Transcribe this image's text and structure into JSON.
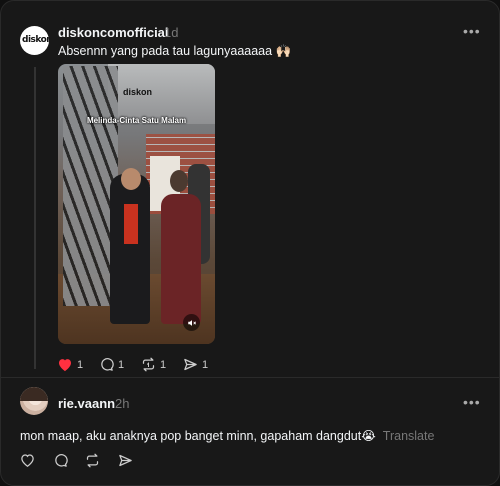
{
  "post": {
    "username": "diskoncomofficial",
    "time": "1d",
    "text": "Absennn yang pada tau lagunyaaaaaa 🙌🏻",
    "avatar_logo": "diskon",
    "more_icon": "more-horizontal-icon",
    "video": {
      "brand_overlay": "diskon",
      "caption": "Melinda-Cinta Satu Malam",
      "mute_icon": "speaker-muted-icon"
    },
    "actions": {
      "likes": "1",
      "comments": "1",
      "reposts": "1",
      "shares": "1"
    },
    "liked": true,
    "like_color": "#ff3040"
  },
  "reply": {
    "username": "rie.vaann",
    "time": "2h",
    "text": "mon maap, aku anaknya pop banget minn, gapaham dangdut😭",
    "translate_label": "Translate",
    "more_icon": "more-horizontal-icon",
    "actions": [
      "heart-icon",
      "comment-icon",
      "repost-icon",
      "share-icon"
    ]
  }
}
